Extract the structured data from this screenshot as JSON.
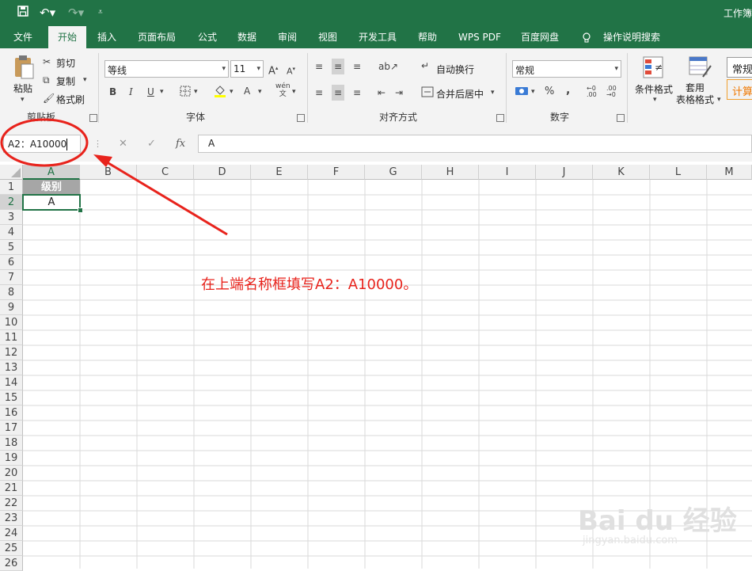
{
  "window": {
    "title": "工作簿"
  },
  "quick_access": {
    "save_icon": "save-icon",
    "undo_icon": "undo-icon",
    "redo_icon": "redo-icon",
    "customize_icon": "customize-icon"
  },
  "tabs": [
    "文件",
    "开始",
    "插入",
    "页面布局",
    "公式",
    "数据",
    "审阅",
    "视图",
    "开发工具",
    "帮助",
    "WPS PDF",
    "百度网盘",
    "操作说明搜索"
  ],
  "ribbon": {
    "clipboard": {
      "paste": "粘贴",
      "cut": "剪切",
      "copy": "复制",
      "format_painter": "格式刷",
      "group": "剪贴板"
    },
    "font": {
      "font_name": "等线",
      "font_size": "11",
      "group": "字体",
      "bold": "B",
      "italic": "I",
      "underline": "U",
      "font_color": "A",
      "phonetic": "wén\n文"
    },
    "alignment": {
      "wrap": "自动换行",
      "merge": "合并后居中",
      "group": "对齐方式"
    },
    "number": {
      "format": "常规",
      "percent": "%",
      "comma": ",",
      "group": "数字"
    },
    "styles": {
      "conditional": "条件格式",
      "table_format": "套用\n表格格式",
      "normal": "常规",
      "calc": "计算"
    }
  },
  "formula_bar": {
    "name_box": "A2：A10000",
    "cancel": "✕",
    "enter": "✓",
    "fx": "fx",
    "content": "A"
  },
  "sheet": {
    "columns": [
      "A",
      "B",
      "C",
      "D",
      "E",
      "F",
      "G",
      "H",
      "I",
      "J",
      "K",
      "L",
      "M"
    ],
    "rows": [
      "1",
      "2",
      "3",
      "4",
      "5",
      "6",
      "7",
      "8",
      "9",
      "10",
      "11",
      "12",
      "13",
      "14",
      "15",
      "16",
      "17",
      "18",
      "19",
      "20",
      "21",
      "22",
      "23",
      "24",
      "25",
      "26"
    ],
    "cells": {
      "A1": "级别",
      "A2": "A"
    }
  },
  "annotation": {
    "text": "在上端名称框填写A2：A10000。",
    "color": "#e8231c"
  },
  "watermark": {
    "logo": "Bai du 经验",
    "url": "jingyan.baidu.com"
  },
  "colors": {
    "accent": "#217346",
    "annotation": "#e8231c"
  }
}
